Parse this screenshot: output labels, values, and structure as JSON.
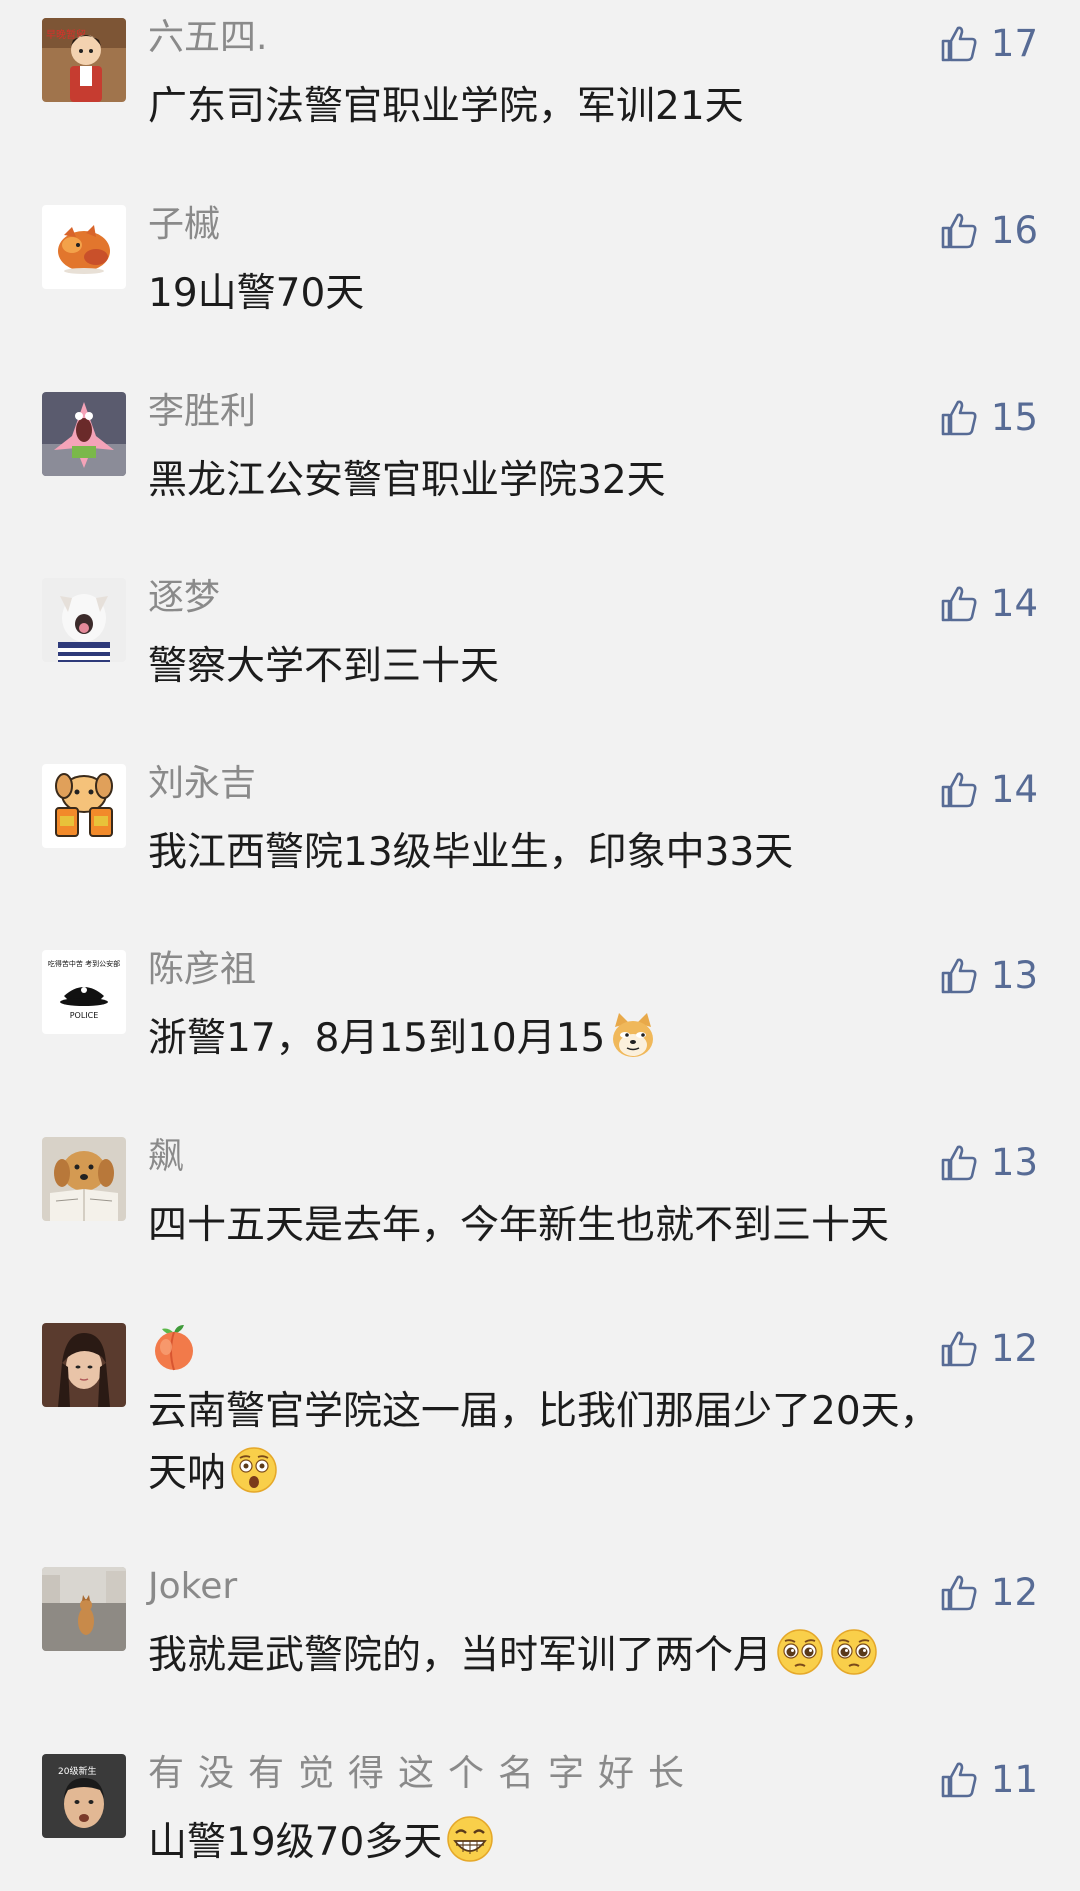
{
  "comments": [
    {
      "username": "六五四.",
      "text": "广东司法警官职业学院，军训21天",
      "likes": "17",
      "avatar": "cartoon-boy-avatar"
    },
    {
      "username": "子槭",
      "text": "19山警70天",
      "likes": "16",
      "avatar": "fox-leaves-avatar"
    },
    {
      "username": "李胜利",
      "text": "黑龙江公安警官职业学院32天",
      "likes": "15",
      "avatar": "patrick-star-avatar"
    },
    {
      "username": "逐梦",
      "text": "警察大学不到三十天",
      "likes": "14",
      "avatar": "dog-yawning-avatar"
    },
    {
      "username": "刘永吉",
      "text": "我江西警院13级毕业生，印象中33天",
      "likes": "14",
      "avatar": "cartoon-dog-avatar"
    },
    {
      "username": "陈彦祖",
      "text": "浙警17，8月15到10月15",
      "likes": "13",
      "avatar": "police-cap-avatar",
      "emoji": "doge-emoji"
    },
    {
      "username": "飙",
      "text": "四十五天是去年，今年新生也就不到三十天",
      "likes": "13",
      "avatar": "golden-retriever-avatar"
    },
    {
      "username": "",
      "text_line1": "云南警官学院这一届，比我们那届少了20天，",
      "text_line2": "天呐",
      "likes": "12",
      "avatar": "girl-photo-avatar",
      "username_emoji": "peach-emoji",
      "emoji": "astonished-emoji"
    },
    {
      "username": "Joker",
      "text": "我就是武警院的，当时军训了两个月",
      "likes": "12",
      "avatar": "street-dog-avatar",
      "emoji": "pleading-emoji"
    },
    {
      "username": "有没有觉得这个名字好长",
      "text": "山警19级70多天",
      "likes": "11",
      "avatar": "boy-photo-avatar",
      "emoji": "grin-emoji"
    }
  ],
  "avatar_texts": {
    "cartoon_boy_sign": "早晚暂留",
    "police_caption": "吃得苦中苦 考到公安部",
    "police_label": "POLICE",
    "boy_badge": "20级新生"
  },
  "colors": {
    "background": "#f2f2f2",
    "like_blue": "#576b95",
    "username_gray": "#8a8a8a"
  }
}
